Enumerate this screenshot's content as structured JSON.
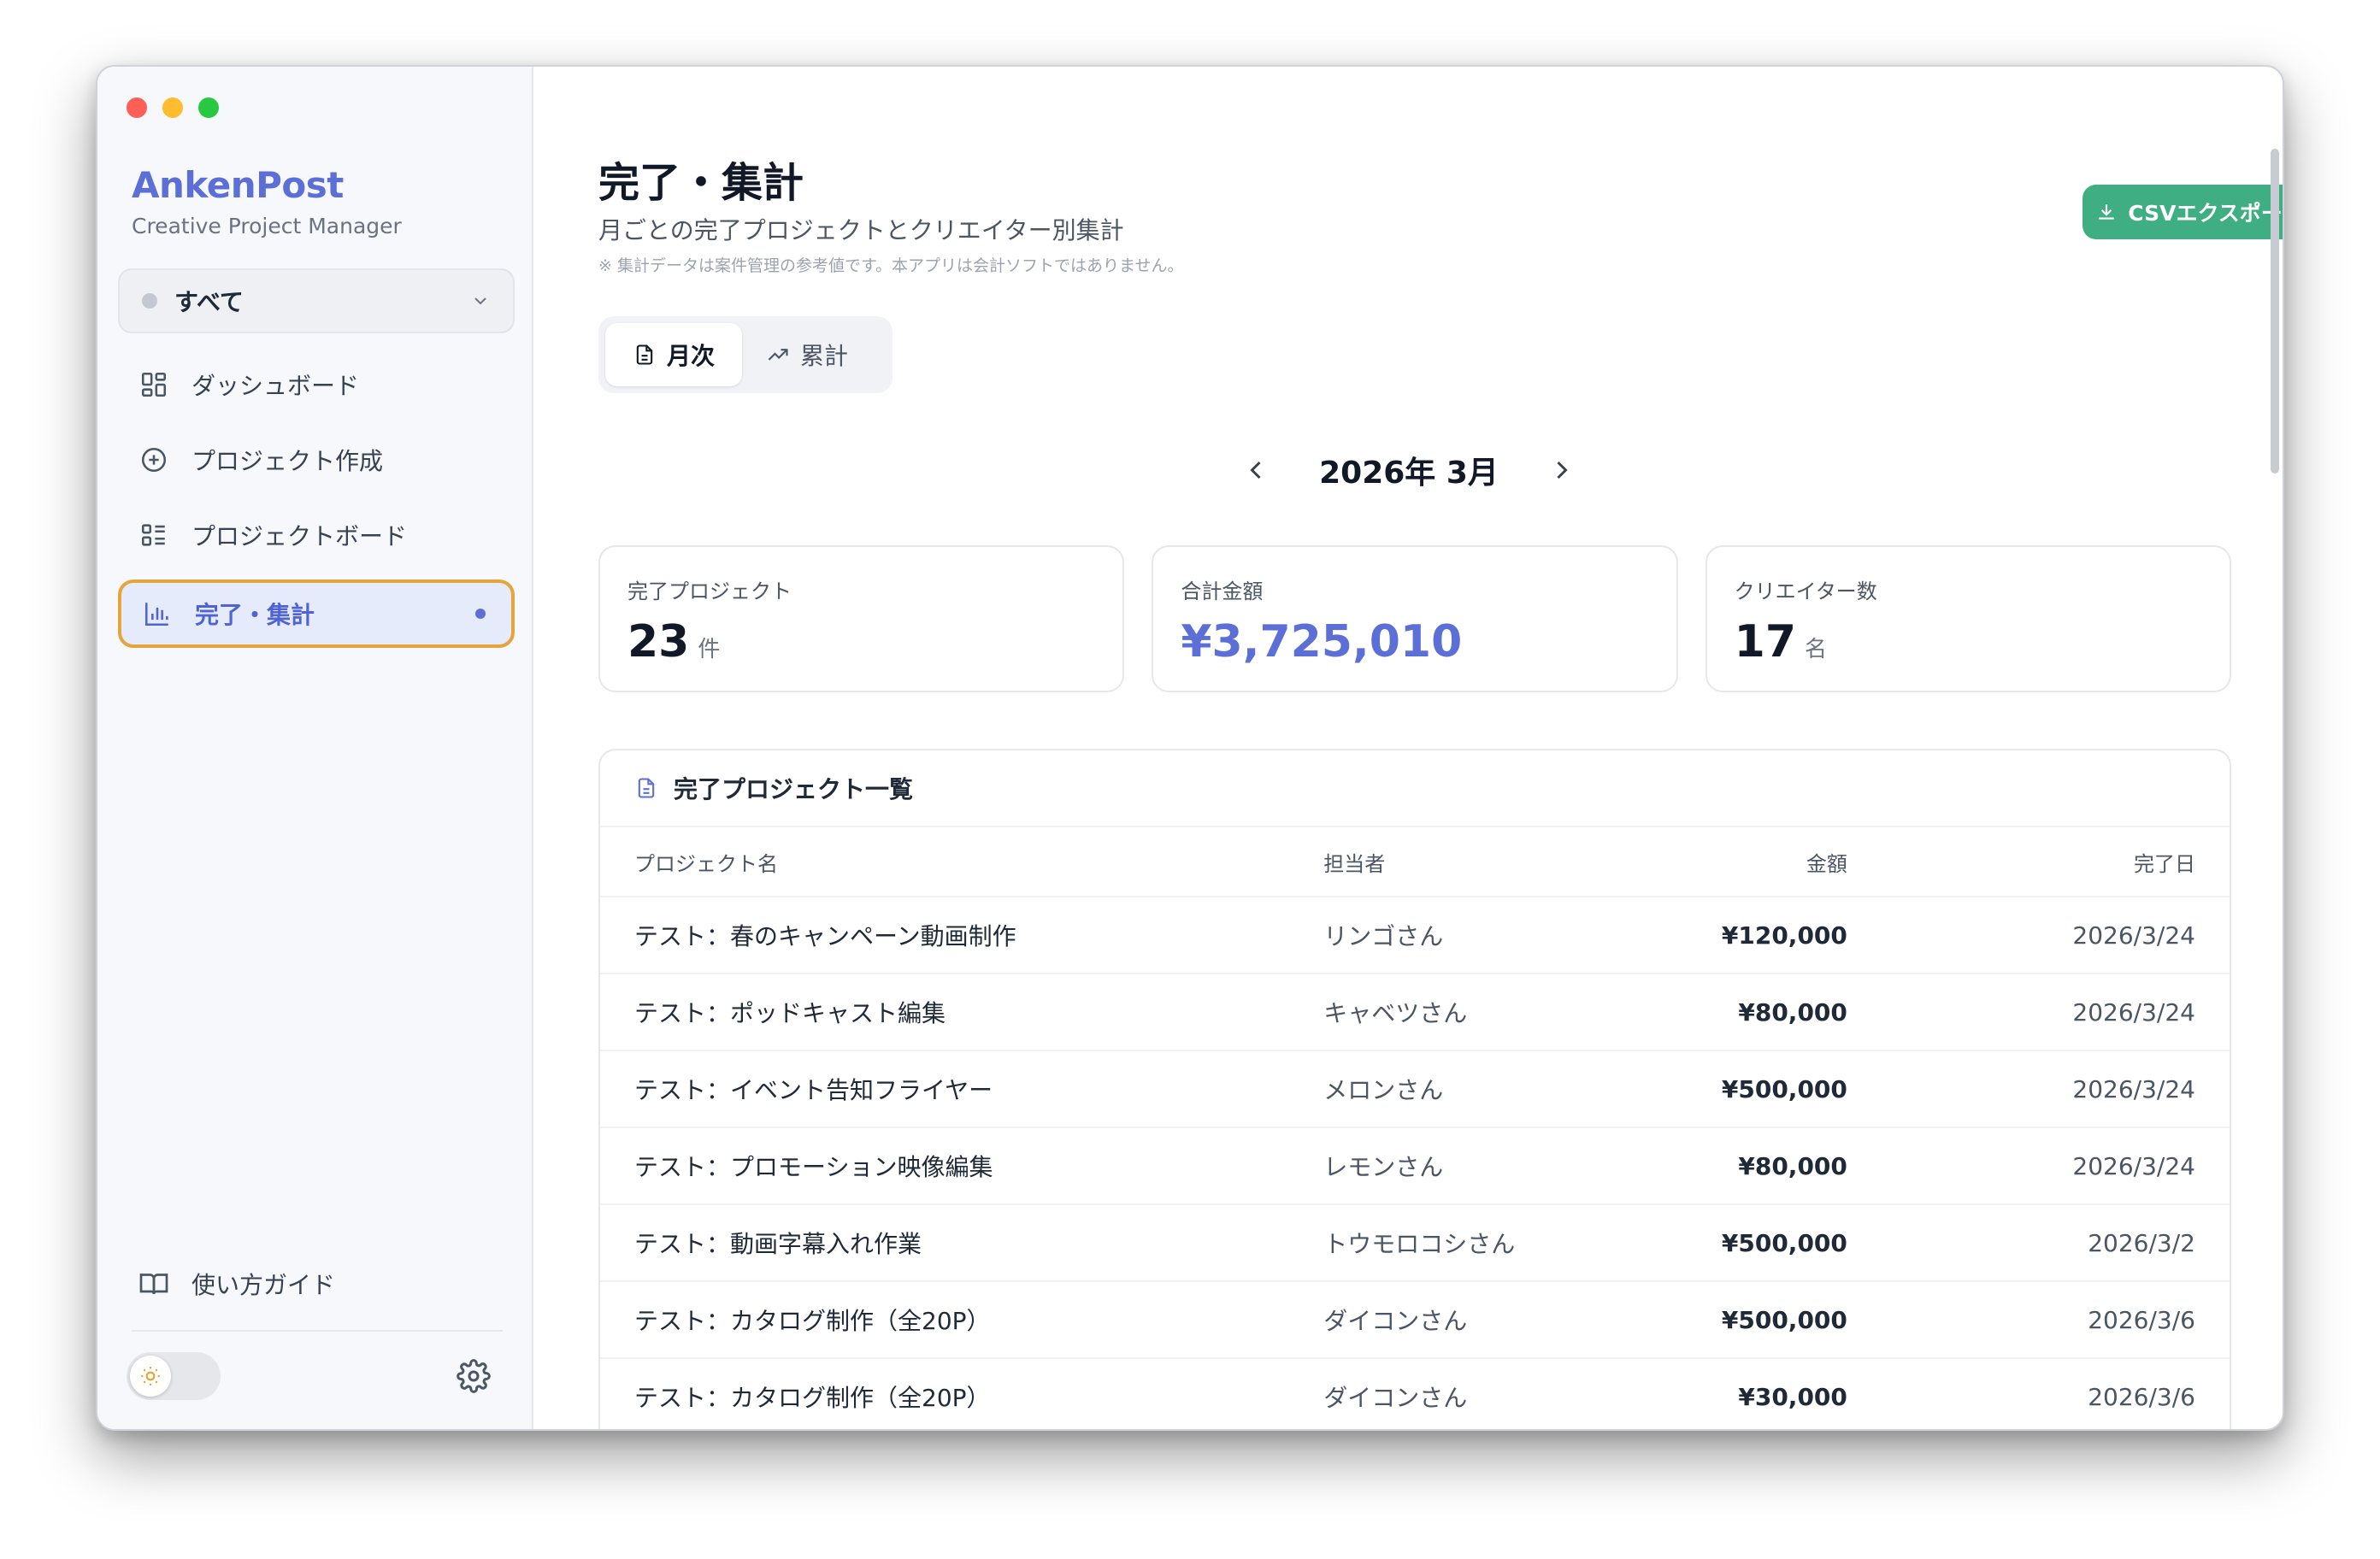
{
  "app": {
    "name": "AnkenPost",
    "tagline": "Creative Project Manager"
  },
  "sidebar": {
    "filter_label": "すべて",
    "items": [
      {
        "label": "ダッシュボード",
        "icon": "dashboard-icon"
      },
      {
        "label": "プロジェクト作成",
        "icon": "plus-circle-icon"
      },
      {
        "label": "プロジェクトボード",
        "icon": "board-list-icon"
      },
      {
        "label": "完了・集計",
        "icon": "bar-chart-icon",
        "active": true
      }
    ],
    "guide_label": "使い方ガイド",
    "theme_toggle": "light"
  },
  "header": {
    "title": "完了・集計",
    "subtitle": "月ごとの完了プロジェクトとクリエイター別集計",
    "note": "※ 集計データは案件管理の参考値です。本アプリは会計ソフトではありません。",
    "export_label": "CSVエクスポート"
  },
  "tabs": [
    {
      "label": "月次",
      "active": true
    },
    {
      "label": "累計",
      "active": false
    }
  ],
  "period": {
    "label": "2026年 3月"
  },
  "stats": [
    {
      "label": "完了プロジェクト",
      "value": "23",
      "unit": "件"
    },
    {
      "label": "合計金額",
      "value": "¥3,725,010",
      "unit": ""
    },
    {
      "label": "クリエイター数",
      "value": "17",
      "unit": "名"
    }
  ],
  "table": {
    "title": "完了プロジェクト一覧",
    "columns": [
      "プロジェクト名",
      "担当者",
      "金額",
      "完了日"
    ],
    "rows": [
      {
        "name": "テスト：春のキャンペーン動画制作",
        "person": "リンゴさん",
        "amount": "¥120,000",
        "date": "2026/3/24"
      },
      {
        "name": "テスト：ポッドキャスト編集",
        "person": "キャベツさん",
        "amount": "¥80,000",
        "date": "2026/3/24"
      },
      {
        "name": "テスト：イベント告知フライヤー",
        "person": "メロンさん",
        "amount": "¥500,000",
        "date": "2026/3/24"
      },
      {
        "name": "テスト：プロモーション映像編集",
        "person": "レモンさん",
        "amount": "¥80,000",
        "date": "2026/3/24"
      },
      {
        "name": "テスト：動画字幕入れ作業",
        "person": "トウモロコシさん",
        "amount": "¥500,000",
        "date": "2026/3/2"
      },
      {
        "name": "テスト：カタログ制作（全20P）",
        "person": "ダイコンさん",
        "amount": "¥500,000",
        "date": "2026/3/6"
      },
      {
        "name": "テスト：カタログ制作（全20P）",
        "person": "ダイコンさん",
        "amount": "¥30,000",
        "date": "2026/3/6"
      }
    ]
  },
  "colors": {
    "accent": "#5b6fd6",
    "export_button": "#3fae83",
    "active_outline": "#e6a53a"
  }
}
